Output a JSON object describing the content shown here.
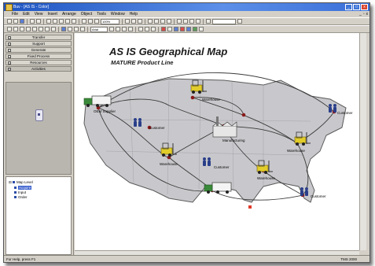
{
  "window": {
    "title": "Buv - [AS IS - Color]",
    "controls": [
      "_",
      "□",
      "x"
    ]
  },
  "menu": {
    "items": [
      "File",
      "Edit",
      "View",
      "Insert",
      "Arrange",
      "Object",
      "Tools",
      "Window",
      "Help"
    ]
  },
  "toolbar": {
    "zoom": "100%",
    "font": "Arial"
  },
  "nav": {
    "buttons": [
      "Transfer",
      "Support",
      "Generate",
      "Fixed Process",
      "Resources",
      "Activities"
    ]
  },
  "tree": {
    "root": "Map Level",
    "children": [
      "Acquire",
      "Input",
      "Order"
    ]
  },
  "map": {
    "title": "AS IS Geographical Map",
    "subtitle": "MATURE Product Line",
    "labels": {
      "supplier": "OEM Supplier",
      "customer_nw": "Customer",
      "warehouse_n": "Warehouse",
      "manufacturing": "Manufacturing",
      "warehouse_w": "Warehouse",
      "customer_c": "Customer",
      "warehouse_s": "Warehouse",
      "warehouse_e": "Warehouse",
      "customer_ne": "Customer",
      "customer_se": "Customer"
    }
  },
  "status": {
    "left": "For Help, press F1",
    "right": "TMS 2000"
  },
  "colors": {
    "titlebar": "#1f55c2",
    "canvas": "#ffffff",
    "map_land": "#c8c8cc",
    "route": "#3a3a3a",
    "node": "#8a1a1a",
    "truck": "#3a8a3a",
    "forklift": "#e2cc2a",
    "person": "#2a3f8a"
  }
}
